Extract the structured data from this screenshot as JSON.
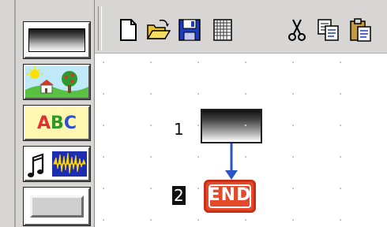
{
  "colors": {
    "chrome": "#d8d6d4",
    "end_fill": "#e24a2a",
    "arrow": "#2a55c8",
    "abc_letters": [
      "#e23030",
      "#2a9a2a",
      "#2a52d0"
    ]
  },
  "palette": {
    "tools": [
      {
        "name": "gradient-background-tool",
        "icon": "gradient-swatch-icon"
      },
      {
        "name": "picture-tool",
        "icon": "landscape-picture-icon"
      },
      {
        "name": "text-tool",
        "icon": "abc-text-icon",
        "label": "ABC"
      },
      {
        "name": "sound-tool",
        "icon": "music-waveform-icon"
      },
      {
        "name": "button-tool",
        "icon": "button-shape-icon"
      }
    ]
  },
  "toolbar": {
    "buttons": [
      {
        "name": "new-button",
        "icon": "new-document-icon"
      },
      {
        "name": "open-button",
        "icon": "open-folder-icon"
      },
      {
        "name": "save-button",
        "icon": "save-disk-icon"
      },
      {
        "name": "grid-button",
        "icon": "grid-icon"
      },
      {
        "name": "cut-button",
        "icon": "scissors-icon"
      },
      {
        "name": "copy-button",
        "icon": "copy-icon"
      },
      {
        "name": "paste-button",
        "icon": "paste-clipboard-icon"
      }
    ]
  },
  "flow": {
    "steps": [
      {
        "number": "1",
        "type": "gradient-background",
        "selected": false
      },
      {
        "number": "2",
        "type": "end",
        "label": "END",
        "selected": true
      }
    ]
  }
}
